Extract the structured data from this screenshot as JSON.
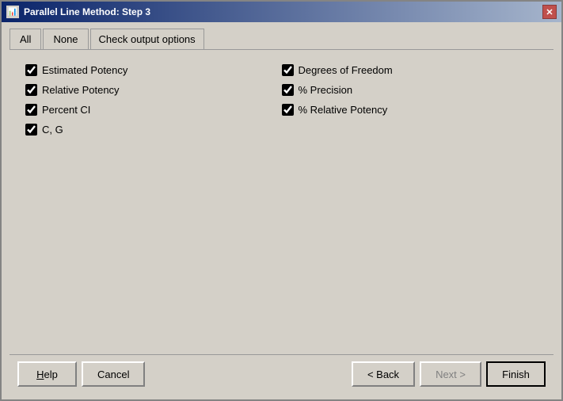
{
  "window": {
    "title": "Parallel Line Method: Step 3",
    "icon": "chart-icon"
  },
  "tabs": {
    "all_label": "All",
    "none_label": "None",
    "active_label": "Check output options"
  },
  "checkboxes_left": [
    {
      "id": "cb1",
      "label": "Estimated Potency",
      "checked": true
    },
    {
      "id": "cb2",
      "label": "Relative Potency",
      "checked": true
    },
    {
      "id": "cb3",
      "label": "Percent CI",
      "checked": true
    },
    {
      "id": "cb4",
      "label": "C, G",
      "checked": true
    }
  ],
  "checkboxes_right": [
    {
      "id": "cb5",
      "label": "Degrees of Freedom",
      "checked": true
    },
    {
      "id": "cb6",
      "label": "% Precision",
      "checked": true
    },
    {
      "id": "cb7",
      "label": "% Relative Potency",
      "checked": true
    }
  ],
  "buttons": {
    "help": "Help",
    "cancel": "Cancel",
    "back": "< Back",
    "next": "Next >",
    "finish": "Finish"
  }
}
